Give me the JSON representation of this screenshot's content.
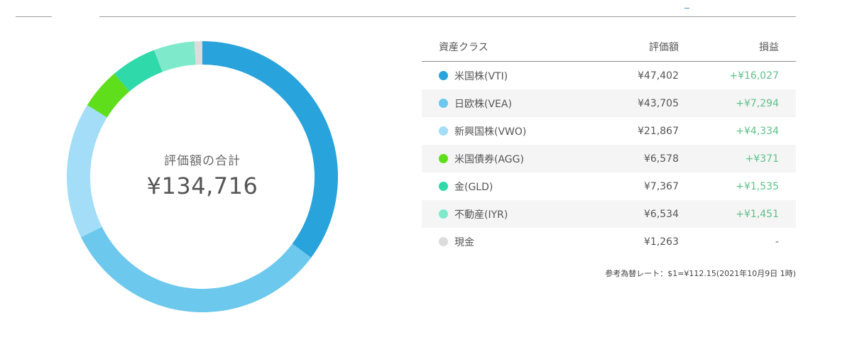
{
  "summary": {
    "label": "評価額の合計",
    "total": "¥134,716"
  },
  "table": {
    "headers": {
      "asset_class": "資産クラス",
      "value": "評価額",
      "profit": "損益"
    },
    "rows": [
      {
        "name": "米国株(VTI)",
        "value": "¥47,402",
        "profit": "+¥16,027",
        "amount": 47402,
        "color": "#29a3dc"
      },
      {
        "name": "日欧株(VEA)",
        "value": "¥43,705",
        "profit": "+¥7,294",
        "amount": 43705,
        "color": "#6cc8ec"
      },
      {
        "name": "新興国株(VWO)",
        "value": "¥21,867",
        "profit": "+¥4,334",
        "amount": 21867,
        "color": "#a3ddf8"
      },
      {
        "name": "米国債券(AGG)",
        "value": "¥6,578",
        "profit": "+¥371",
        "amount": 6578,
        "color": "#5fde1c"
      },
      {
        "name": "金(GLD)",
        "value": "¥7,367",
        "profit": "+¥1,535",
        "amount": 7367,
        "color": "#2fd9a9"
      },
      {
        "name": "不動産(IYR)",
        "value": "¥6,534",
        "profit": "+¥1,451",
        "amount": 6534,
        "color": "#7fe9cb"
      },
      {
        "name": "現金",
        "value": "¥1,263",
        "profit": "-",
        "amount": 1263,
        "color": "#dcdcdc"
      }
    ],
    "note": "参考為替レート：$1=¥112.15(2021年10月9日 1時)"
  },
  "colors": {
    "profit_positive": "#5fc08a",
    "divider": "#9a9a9a",
    "accent": "#3a8fd8"
  }
}
